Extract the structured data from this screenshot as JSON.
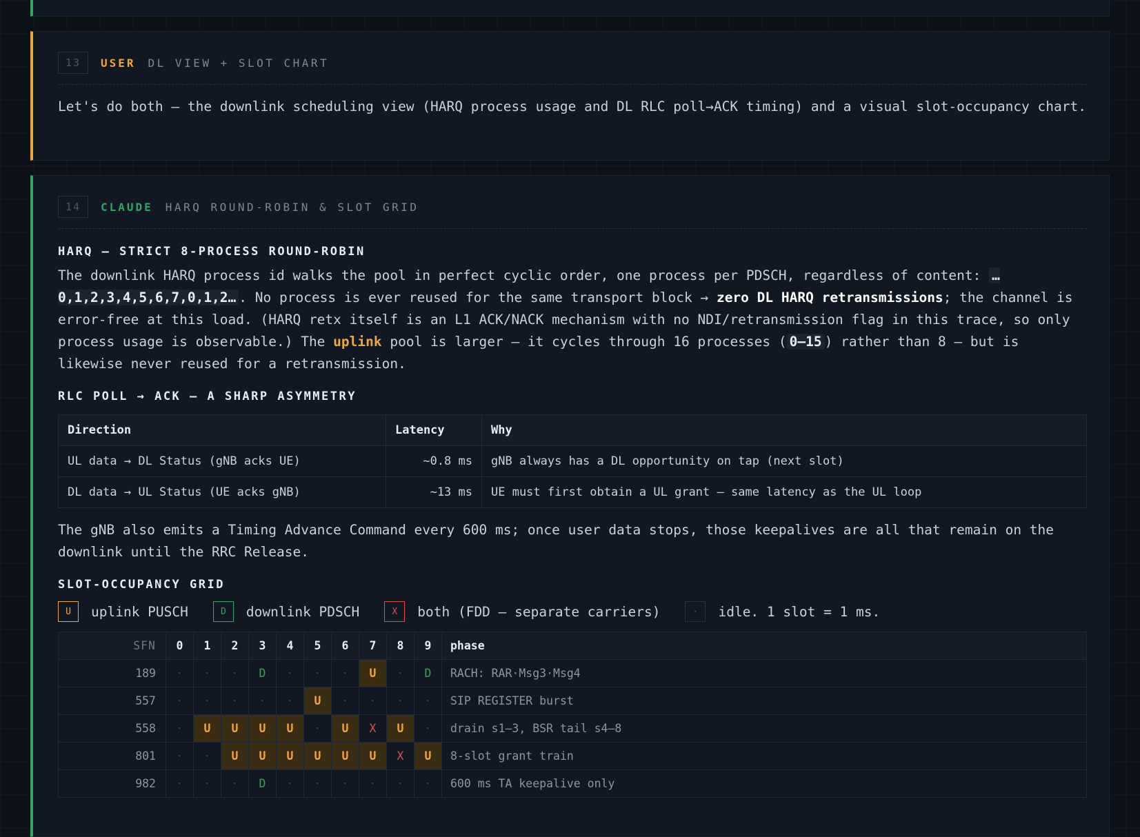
{
  "colors": {
    "user_accent": "#f0a53a",
    "claude_accent": "#2aa864",
    "both_accent": "#e5484d",
    "background": "#0c1118"
  },
  "user_msg": {
    "num": "13",
    "role": "USER",
    "subtitle": "DL VIEW + SLOT CHART",
    "text": "Let's do both — the downlink scheduling view (HARQ process usage and DL RLC poll→ACK timing) and a visual slot-occupancy chart."
  },
  "claude_msg": {
    "num": "14",
    "role": "CLAUDE",
    "subtitle": "HARQ ROUND-ROBIN & SLOT GRID",
    "harq": {
      "heading": "HARQ — STRICT 8-PROCESS ROUND-ROBIN",
      "p1": "The downlink HARQ process id walks the pool in perfect cyclic order, one process per PDSCH, regardless of content: ",
      "code1": "… 0,1,2,3,4,5,6,7,0,1,2…",
      "p2": ". No process is ever reused for the same transport block → ",
      "bold1": "zero DL HARQ retransmissions",
      "p3": "; the channel is error-free at this load. (HARQ retx itself is an L1 ACK/NACK mechanism with no NDI/retransmission flag in this trace, so only process usage is observable.) The ",
      "hl1": "uplink",
      "p4": " pool is larger — it cycles through 16 processes (",
      "code2": "0–15",
      "p5": ") rather than 8 — but is likewise never reused for a retransmission."
    },
    "rlc": {
      "heading": "RLC POLL → ACK — A SHARP ASYMMETRY",
      "columns": [
        "Direction",
        "Latency",
        "Why"
      ],
      "rows": [
        {
          "direction": "UL data → DL Status (gNB acks UE)",
          "latency": "~0.8 ms",
          "why": "gNB always has a DL opportunity on tap (next slot)"
        },
        {
          "direction": "DL data → UL Status (UE acks gNB)",
          "latency": "~13 ms",
          "why": "UE must first obtain a UL grant — same latency as the UL loop"
        }
      ],
      "after": "The gNB also emits a Timing Advance Command every 600 ms; once user data stops, those keepalives are all that remain on the downlink until the RRC Release."
    },
    "grid": {
      "heading": "SLOT-OCCUPANCY GRID",
      "legend": [
        {
          "symbol": "U",
          "label": "uplink PUSCH"
        },
        {
          "symbol": "D",
          "label": "downlink PDSCH"
        },
        {
          "symbol": "X",
          "label": "both (FDD — separate carriers)"
        },
        {
          "symbol": "·",
          "label": "idle. 1 slot = 1 ms."
        }
      ],
      "sfn_label": "SFN",
      "phase_label": "phase",
      "slot_labels": [
        "0",
        "1",
        "2",
        "3",
        "4",
        "5",
        "6",
        "7",
        "8",
        "9"
      ],
      "rows": [
        {
          "sfn": "189",
          "cells": [
            "·",
            "·",
            "·",
            "D",
            "·",
            "·",
            "·",
            "U",
            "·",
            "D"
          ],
          "phase": "RACH: RAR·Msg3·Msg4"
        },
        {
          "sfn": "557",
          "cells": [
            "·",
            "·",
            "·",
            "·",
            "·",
            "U",
            "·",
            "·",
            "·",
            "·"
          ],
          "phase": "SIP REGISTER burst"
        },
        {
          "sfn": "558",
          "cells": [
            "·",
            "U",
            "U",
            "U",
            "U",
            "·",
            "U",
            "X",
            "U",
            "·"
          ],
          "phase": "drain s1–3, BSR tail s4–8"
        },
        {
          "sfn": "801",
          "cells": [
            "·",
            "·",
            "U",
            "U",
            "U",
            "U",
            "U",
            "U",
            "X",
            "U"
          ],
          "phase": "8-slot grant train"
        },
        {
          "sfn": "982",
          "cells": [
            "·",
            "·",
            "·",
            "D",
            "·",
            "·",
            "·",
            "·",
            "·",
            "·"
          ],
          "phase": "600 ms TA keepalive only"
        }
      ]
    }
  }
}
